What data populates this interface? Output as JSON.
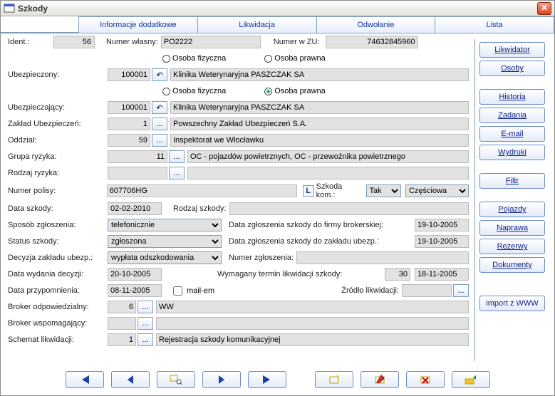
{
  "window": {
    "title": "Szkody"
  },
  "tabs": {
    "t1": "Informacje dodatkowe",
    "t2": "Likwidacja",
    "t3": "Odwołanie",
    "t4": "Lista"
  },
  "header": {
    "ident_label": "Ident.:",
    "ident_value": "56",
    "own_no_label": "Numer własny:",
    "own_no_value": "PO2222",
    "zu_no_label": "Numer w ZU:",
    "zu_no_value": "74632845960"
  },
  "radio": {
    "osoba_fiz": "Osoba fizyczna",
    "osoba_praw": "Osoba prawna"
  },
  "rows": {
    "ubezpieczony_lbl": "Ubezpieczony:",
    "ubezpieczony_code": "100001",
    "ubezpieczony_name": "Klinika Weterynaryjna PASZCZAK SA",
    "ubezpieczajacy_lbl": "Ubezpieczający:",
    "ubezpieczajacy_code": "100001",
    "ubezpieczajacy_name": "Klinika Weterynaryjna PASZCZAK SA",
    "zaklad_lbl": "Zakład Ubezpieczeń:",
    "zaklad_code": "1",
    "zaklad_name": "Powszechny Zakład Ubezpieczeń S.A.",
    "oddzial_lbl": "Oddział:",
    "oddzial_code": "59",
    "oddzial_name": "Inspektorat we Włocławku",
    "grupa_lbl": "Grupa ryzyka:",
    "grupa_code": "11",
    "grupa_name": "OC - pojazdów powietrznych, OC - przewoźnika powietrznego",
    "rodzaj_ryz_lbl": "Rodzaj ryzyka:",
    "numer_polisy_lbl": "Numer polisy:",
    "numer_polisy_val": "607706HG",
    "szkoda_kom_lbl": "Szkoda kom.:",
    "szkoda_kom_val": "Tak",
    "szkoda_kom_partial": "Częściowa",
    "data_szkody_lbl": "Data szkody:",
    "data_szkody_val": "02-02-2010",
    "rodzaj_szkody_lbl": "Rodzaj szkody:",
    "sposob_zgl_lbl": "Sposób zgłoszenia:",
    "sposob_zgl_val": "telefonicznie",
    "status_lbl": "Status szkody:",
    "status_val": "zgłoszona",
    "decyzja_lbl": "Decyzja zakładu ubezp.:",
    "decyzja_val": "wypłata odszkodowania",
    "data_zgl_broker_lbl": "Data zgłoszenia szkody do firmy brokerskiej:",
    "data_zgl_broker_val": "19-10-2005",
    "data_zgl_zu_lbl": "Data zgłoszenia szkody do zakładu ubezp.:",
    "data_zgl_zu_val": "19-10-2005",
    "numer_zgl_lbl": "Numer zgłoszenia:",
    "data_wyd_lbl": "Data wydania decyzji:",
    "data_wyd_val": "20-10-2005",
    "wymagany_lbl": "Wymagany termin likwidacji szkody:",
    "wymagany_days": "30",
    "wymagany_date": "18-11-2005",
    "data_przyp_lbl": "Data przypomnienia:",
    "data_przyp_val": "08-11-2005",
    "mailem_lbl": "mail-em",
    "zrodlo_lbl": "Źródło likwidacji:",
    "broker_odp_lbl": "Broker odpowiedzialny:",
    "broker_odp_code": "6",
    "broker_odp_name": "WW",
    "broker_wsp_lbl": "Broker wspomagający:",
    "schemat_lbl": "Schemat likwidacji:",
    "schemat_code": "1",
    "schemat_name": "Rejestracja szkody komunikacyjnej"
  },
  "sidebar": {
    "likwidator": "Likwidator",
    "osoby": "Osoby",
    "historia": "Historia",
    "zadania": "Zadania",
    "email": "E-mail",
    "wydruki": "Wydruki",
    "filtr": "Filtr",
    "pojazdy": "Pojazdy",
    "naprawa": "Naprawa",
    "rezerwy": "Rezerwy",
    "dokumenty": "Dokumenty",
    "import": "import z WWW"
  },
  "buttons": {
    "undo": "↶",
    "lookup": "...",
    "legend": "L"
  }
}
